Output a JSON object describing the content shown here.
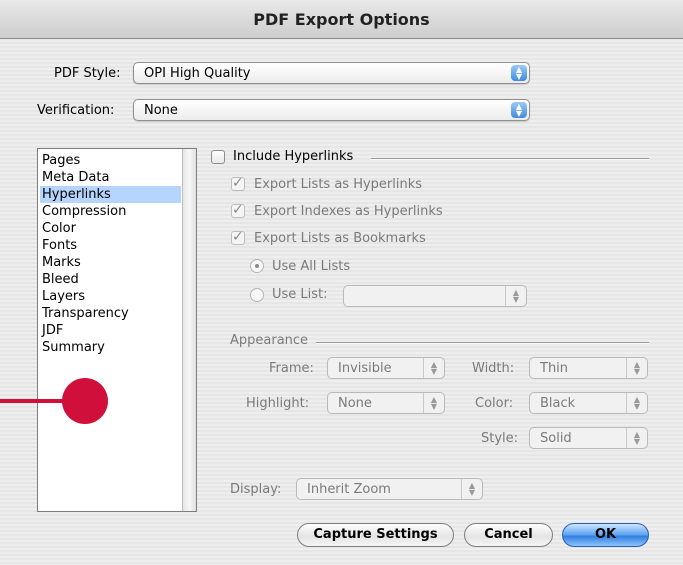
{
  "window": {
    "title": "PDF Export Options"
  },
  "pdf_style": {
    "label": "PDF Style:",
    "value": "OPI High Quality"
  },
  "verification": {
    "label": "Verification:",
    "value": "None"
  },
  "sections": [
    "Pages",
    "Meta Data",
    "Hyperlinks",
    "Compression",
    "Color",
    "Fonts",
    "Marks",
    "Bleed",
    "Layers",
    "Transparency",
    "JDF",
    "Summary"
  ],
  "selected_section": "Hyperlinks",
  "hyperlinks": {
    "include_label": "Include Hyperlinks",
    "include_checked": false,
    "export_lists_label": "Export Lists as Hyperlinks",
    "export_indexes_label": "Export Indexes as Hyperlinks",
    "export_bookmarks_label": "Export Lists as Bookmarks",
    "use_all_lists_label": "Use All Lists",
    "use_list_label": "Use List:",
    "use_list_value": ""
  },
  "appearance": {
    "group_label": "Appearance",
    "frame_label": "Frame:",
    "frame_value": "Invisible",
    "width_label": "Width:",
    "width_value": "Thin",
    "highlight_label": "Highlight:",
    "highlight_value": "None",
    "color_label": "Color:",
    "color_value": "Black",
    "style_label": "Style:",
    "style_value": "Solid"
  },
  "display": {
    "label": "Display:",
    "value": "Inherit Zoom"
  },
  "buttons": {
    "capture": "Capture Settings",
    "cancel": "Cancel",
    "ok": "OK"
  },
  "colors": {
    "selection": "#b5d4fe",
    "accent_blue": "#3f8be0",
    "annotation_red": "#d0103a"
  }
}
